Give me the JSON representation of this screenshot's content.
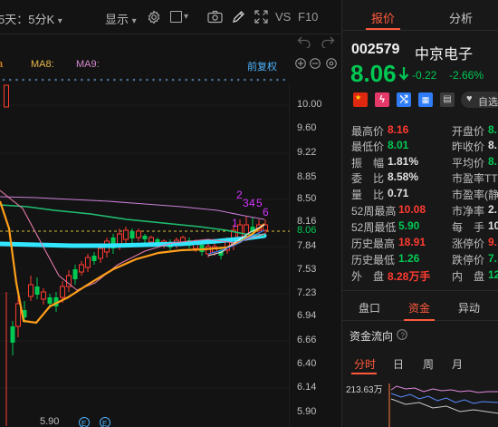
{
  "toolbar": {
    "period": "5天：5分K",
    "display": "显示",
    "vs": "VS",
    "f10": "F10"
  },
  "ma": {
    "ma8": "MA8:",
    "ma9": "MA9:",
    "fuquan": "前复权"
  },
  "price_axis": [
    "10.00",
    "9.60",
    "9.22",
    "8.85",
    "8.50",
    "8.16",
    "8.06",
    "7.84",
    "7.53",
    "7.23",
    "6.94",
    "6.66",
    "6.40",
    "6.14",
    "5.90"
  ],
  "chart_labels": {
    "low_price": "5.90",
    "signal_digits": [
      "1",
      "2",
      "3",
      "4",
      "5",
      "6"
    ]
  },
  "colors": {
    "up": "#ff3b30",
    "down": "#00c853",
    "accent": "#ff5a3c",
    "ma_cyan": "#33e6ff",
    "ma_orange": "#ff9f1a",
    "ma_green": "#20c070",
    "ma_pink": "#d58bd0",
    "signal": "#d535ff"
  },
  "tabs": {
    "quote": "报价",
    "analysis": "分析"
  },
  "stock": {
    "code": "002579",
    "name": "中京电子",
    "price": "8.06",
    "change": "-0.22",
    "change_pct": "-2.66%",
    "watchlist": "自选"
  },
  "stats": {
    "high_label": "最高价",
    "high": "8.16",
    "open_label": "开盘价",
    "open": "8.",
    "low_label": "最低价",
    "low": "8.01",
    "prev_close_label": "昨收价",
    "prev_close": "8.",
    "amplitude_label": "振　幅",
    "amplitude": "1.81%",
    "avg_label": "平均价",
    "avg": "8.",
    "ratio_label": "委　比",
    "ratio": "8.58%",
    "pe_ttm_label": "市盈率TTM",
    "pe_ttm": "",
    "vol_ratio_label": "量　比",
    "vol_ratio": "0.71",
    "pe_static_label": "市盈率(静",
    "pe_static": "",
    "w52_high_label": "52周最高",
    "w52_high": "10.08",
    "pb_label": "市净率",
    "pb": "2.",
    "w52_low_label": "52周最低",
    "w52_low": "5.90",
    "lot_label": "每　手",
    "lot": "10",
    "hist_high_label": "历史最高",
    "hist_high": "18.91",
    "limit_up_label": "涨停价",
    "limit_up": "9.",
    "hist_low_label": "历史最低",
    "hist_low": "1.26",
    "limit_down_label": "跌停价",
    "limit_down": "7.",
    "outer_label": "外　盘",
    "outer": "8.28万手",
    "inner_label": "内　盘",
    "inner": "12"
  },
  "sub_tabs": {
    "handicap": "盘口",
    "capital": "资金",
    "abnormal": "异动"
  },
  "capital_flow": {
    "title": "资金流向",
    "periods": [
      "分时",
      "日",
      "周",
      "月"
    ],
    "value": "213.63万"
  }
}
